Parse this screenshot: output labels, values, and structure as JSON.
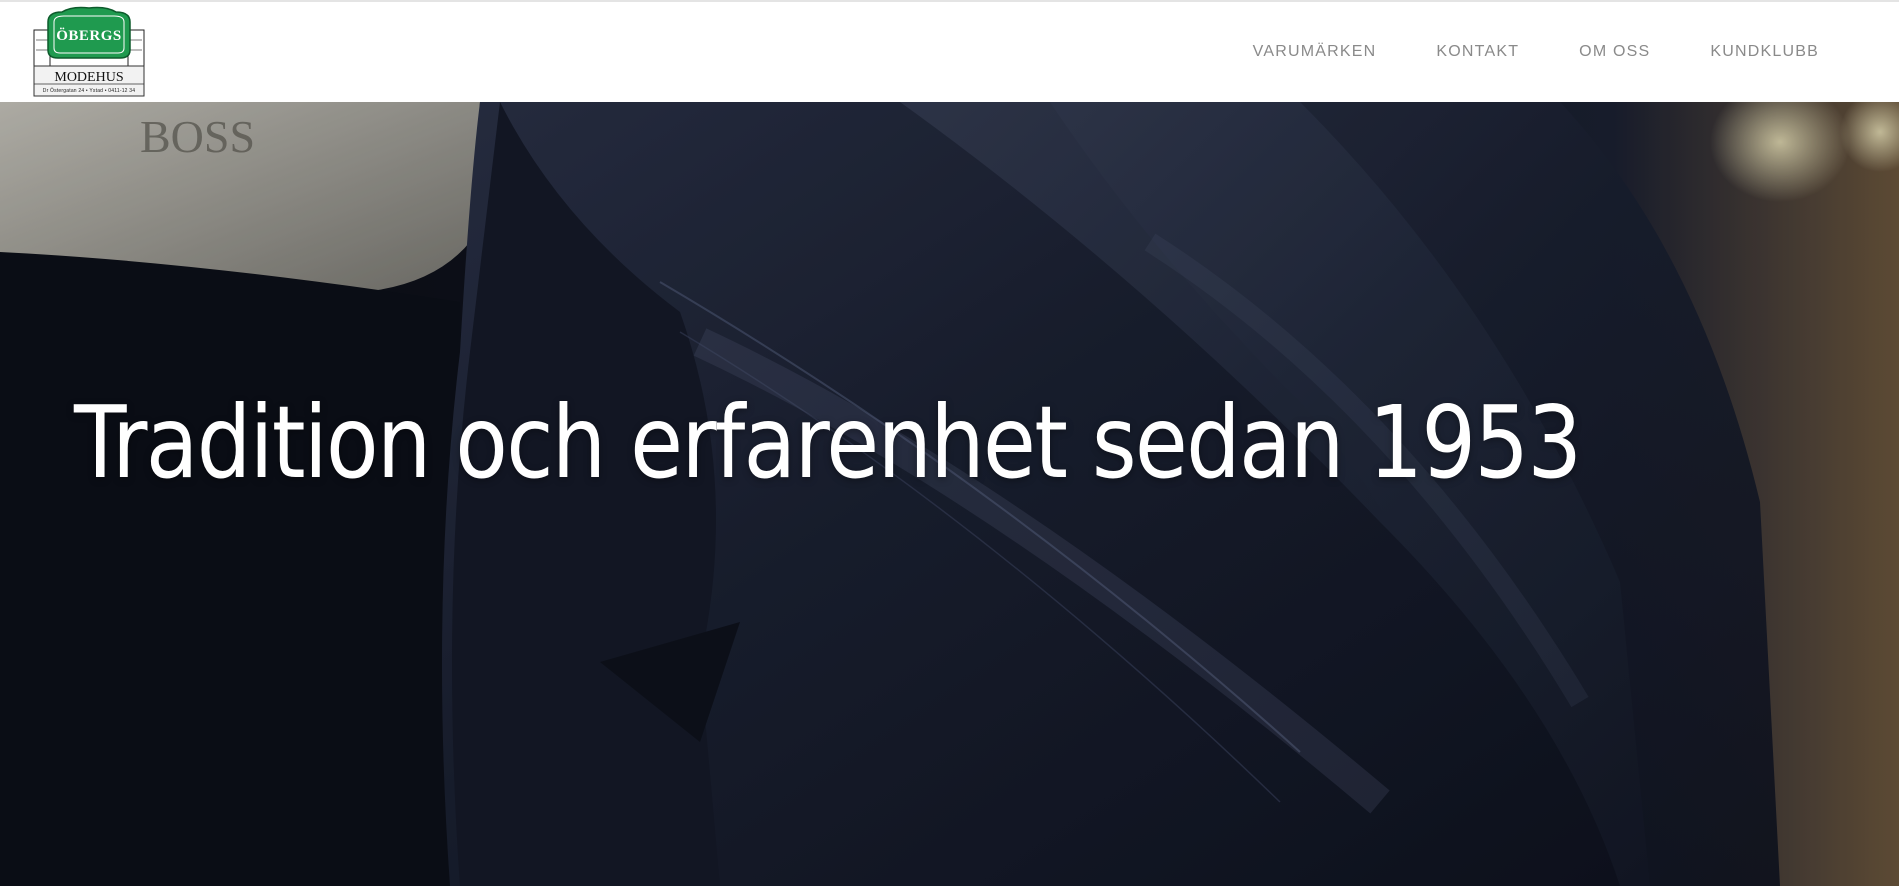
{
  "header": {
    "logo": {
      "brand": "ÖBERGS",
      "store": "MODEHUS",
      "address": "Dr Östergatan 24 • Ystad • 0411-12 34"
    },
    "nav": [
      {
        "label": "VARUMÄRKEN"
      },
      {
        "label": "KONTAKT"
      },
      {
        "label": "OM OSS"
      },
      {
        "label": "KUNDKLUBB"
      }
    ]
  },
  "hero": {
    "title": "Tradition och erfarenhet sedan 1953",
    "background_description": "jackets-on-rack-photo"
  },
  "colors": {
    "logo_green": "#1f9a4f",
    "nav_text": "#8a8a8a",
    "hero_text": "#ffffff",
    "jacket_navy": "#1c2233"
  }
}
